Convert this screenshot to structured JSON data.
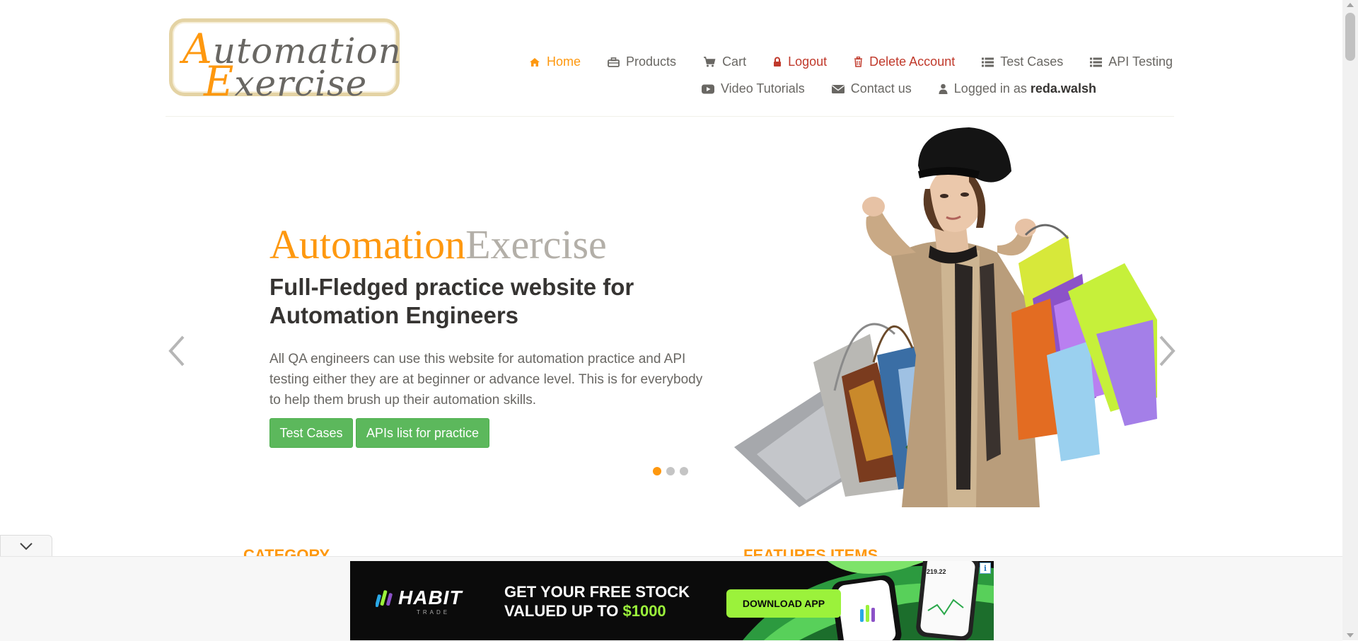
{
  "logo": {
    "line1_cap": "A",
    "line1_rest": "utomation",
    "line2_cap": "E",
    "line2_rest": "xercise"
  },
  "nav": {
    "row1": [
      {
        "label": "Home",
        "icon": "home-icon"
      },
      {
        "label": "Products",
        "icon": "briefcase-icon"
      },
      {
        "label": "Cart",
        "icon": "cart-icon"
      },
      {
        "label": "Logout",
        "icon": "lock-icon"
      },
      {
        "label": "Delete Account",
        "icon": "trash-icon"
      },
      {
        "label": "Test Cases",
        "icon": "list-icon"
      },
      {
        "label": "API Testing",
        "icon": "list-icon"
      }
    ],
    "row2": [
      {
        "label": "Video Tutorials",
        "icon": "youtube-play-icon"
      },
      {
        "label": "Contact us",
        "icon": "envelope-icon"
      },
      {
        "label": "Logged in as",
        "icon": "user-icon",
        "username": "reda.walsh"
      }
    ]
  },
  "slider": {
    "brand_a": "Automation",
    "brand_b": "Exercise",
    "title": "Full-Fledged practice website for Automation Engineers",
    "text": "All QA engineers can use this website for automation practice and API testing either they are at beginner or advance level. This is for everybody to help them brush up their automation skills.",
    "button_test_cases": "Test Cases",
    "button_apis": "APIs list for practice",
    "active_slide": 1,
    "slide_count": 3,
    "prev_icon": "chevron-left-icon",
    "next_icon": "chevron-right-icon"
  },
  "sections": {
    "category": "CATEGORY",
    "features": "FEATURES ITEMS"
  },
  "ad": {
    "brand": "HABIT",
    "brand_sub": "TRADE",
    "headline_line1": "GET YOUR FREE STOCK",
    "headline_line2_prefix": "VALUED UP TO ",
    "headline_line2_amount": "$1000",
    "cta": "DOWNLOAD APP",
    "info": "i",
    "phone_value": "219.22"
  },
  "colors": {
    "accent": "#FE980F",
    "button_green": "#5cb85c",
    "danger": "#c0392b",
    "ad_green": "#9BF23B"
  }
}
